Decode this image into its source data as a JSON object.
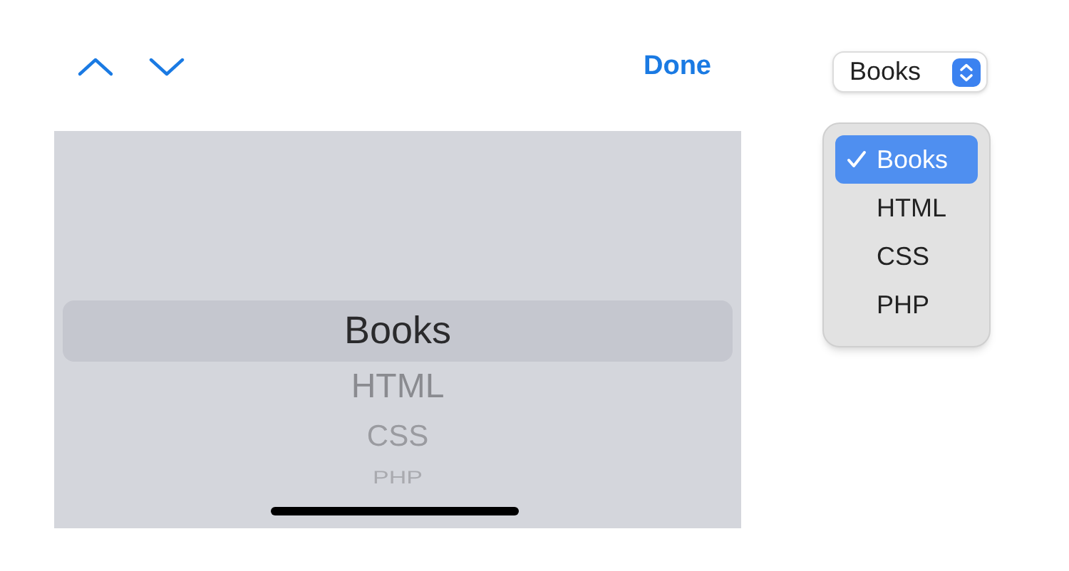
{
  "toolbar": {
    "done_label": "Done"
  },
  "picker": {
    "items": [
      {
        "label": "Books",
        "selected": true
      },
      {
        "label": "HTML",
        "selected": false
      },
      {
        "label": "CSS",
        "selected": false
      },
      {
        "label": "PHP",
        "selected": false
      }
    ]
  },
  "select": {
    "value": "Books"
  },
  "menu": {
    "items": [
      {
        "label": "Books",
        "selected": true
      },
      {
        "label": "HTML",
        "selected": false
      },
      {
        "label": "CSS",
        "selected": false
      },
      {
        "label": "PHP",
        "selected": false
      }
    ]
  }
}
